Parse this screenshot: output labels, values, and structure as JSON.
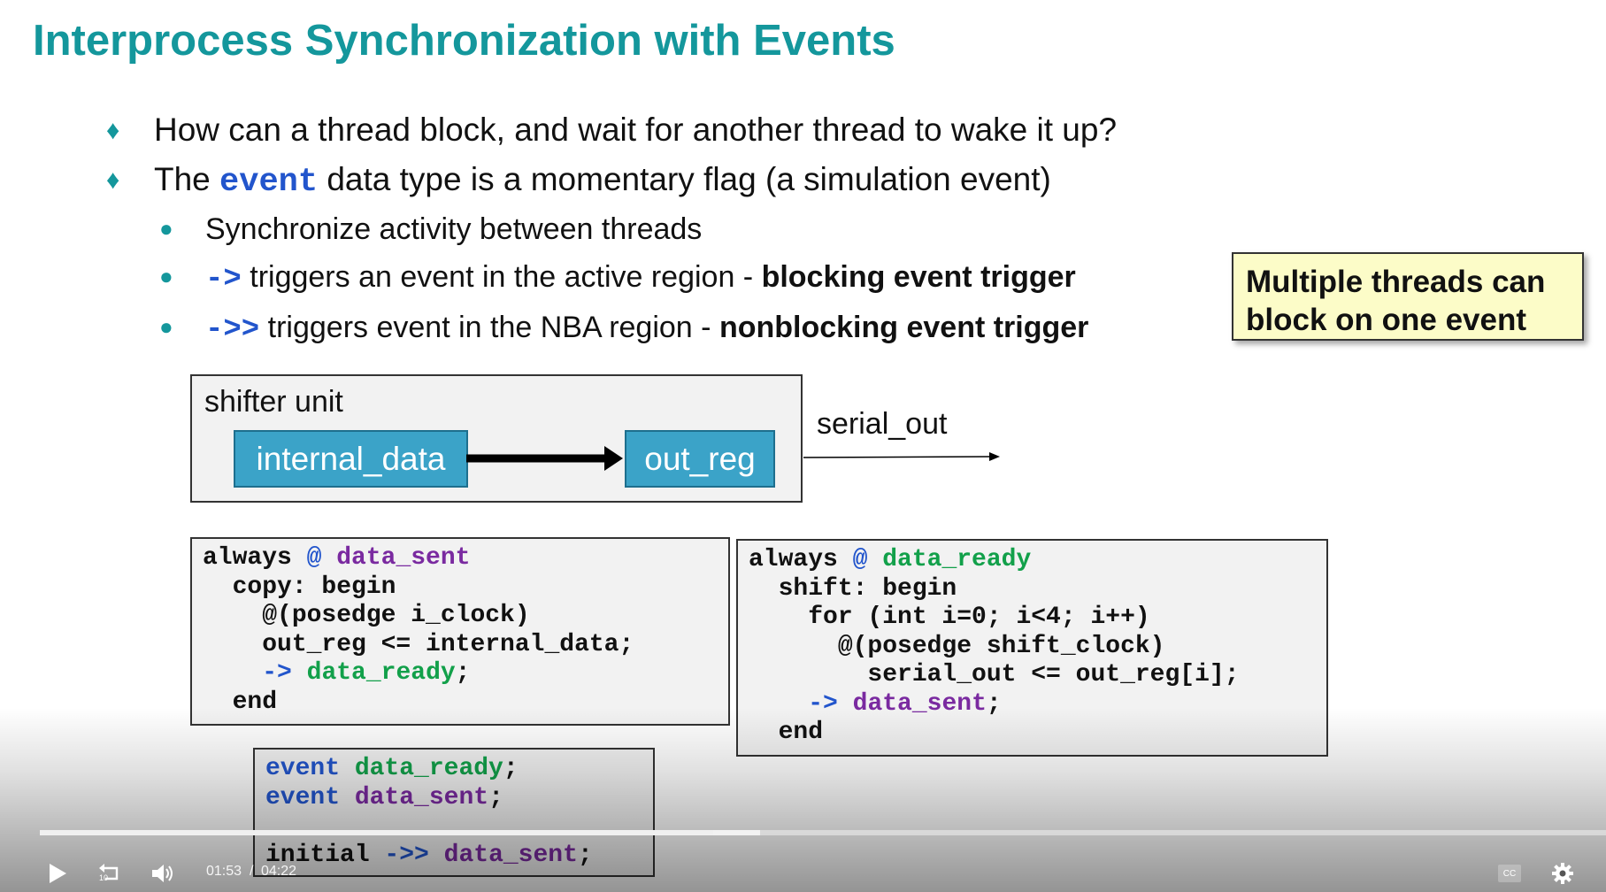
{
  "slide": {
    "title": "Interprocess Synchronization with Events",
    "bullets": [
      {
        "pre": "How can a thread block, and wait for another thread to wake it up?"
      },
      {
        "pre": "The ",
        "code": "event",
        "post": " data type is a momentary flag (a simulation event)"
      }
    ],
    "subbullets": [
      {
        "code": "",
        "text": "Synchronize activity between threads",
        "bold": ""
      },
      {
        "code": "->",
        "text": " triggers an event in the active region - ",
        "bold": "blocking event trigger"
      },
      {
        "code": "->>",
        "text": " triggers event in the NBA region - ",
        "bold": "nonblocking event trigger"
      }
    ],
    "callout": {
      "line1": "Multiple threads can",
      "line2": "block on one event"
    },
    "diagram": {
      "box_label": "shifter unit",
      "left_register": "internal_data",
      "right_register": "out_reg",
      "output_label": "serial_out"
    },
    "code_left": [
      [
        {
          "t": "always ",
          "c": ""
        },
        {
          "t": "@ ",
          "c": "blue"
        },
        {
          "t": "data_sent",
          "c": "purple"
        }
      ],
      [
        {
          "t": "  copy: begin",
          "c": ""
        }
      ],
      [
        {
          "t": "    @(posedge i_clock)",
          "c": ""
        }
      ],
      [
        {
          "t": "    out_reg <= internal_data;",
          "c": ""
        }
      ],
      [
        {
          "t": "    ",
          "c": ""
        },
        {
          "t": "->",
          "c": "blue"
        },
        {
          "t": " ",
          "c": ""
        },
        {
          "t": "data_ready",
          "c": "green"
        },
        {
          "t": ";",
          "c": ""
        }
      ],
      [
        {
          "t": "  end",
          "c": ""
        }
      ]
    ],
    "code_right": [
      [
        {
          "t": "always ",
          "c": ""
        },
        {
          "t": "@ ",
          "c": "blue"
        },
        {
          "t": "data_ready",
          "c": "green"
        }
      ],
      [
        {
          "t": "  shift: begin",
          "c": ""
        }
      ],
      [
        {
          "t": "    for (int i=0; i<4; i++)",
          "c": ""
        }
      ],
      [
        {
          "t": "      @(posedge shift_clock)",
          "c": ""
        }
      ],
      [
        {
          "t": "        serial_out <= out_reg[i];",
          "c": ""
        }
      ],
      [
        {
          "t": "    ",
          "c": ""
        },
        {
          "t": "->",
          "c": "blue"
        },
        {
          "t": " ",
          "c": ""
        },
        {
          "t": "data_sent",
          "c": "purple"
        },
        {
          "t": ";",
          "c": ""
        }
      ],
      [
        {
          "t": "  end",
          "c": ""
        }
      ]
    ],
    "code_bottom": [
      [
        {
          "t": "event ",
          "c": "blue"
        },
        {
          "t": "data_ready",
          "c": "green"
        },
        {
          "t": ";",
          "c": ""
        }
      ],
      [
        {
          "t": "event ",
          "c": "blue"
        },
        {
          "t": "data_sent",
          "c": "purple"
        },
        {
          "t": ";",
          "c": ""
        }
      ],
      [
        {
          "t": " ",
          "c": ""
        }
      ],
      [
        {
          "t": "initial ",
          "c": ""
        },
        {
          "t": "->>",
          "c": "blue"
        },
        {
          "t": " ",
          "c": ""
        },
        {
          "t": "data_sent",
          "c": "purple"
        },
        {
          "t": ";",
          "c": ""
        }
      ]
    ]
  },
  "player": {
    "current_time": "01:53",
    "separator": "/",
    "duration": "04:22",
    "played_fraction": 0.43,
    "buffered_fraction": 0.46,
    "replay_seconds": "10",
    "icons": {
      "play": "play-icon",
      "replay": "replay-10-icon",
      "volume": "volume-icon",
      "captions": "closed-captions-icon",
      "settings": "gear-icon"
    },
    "captions_label": "CC"
  }
}
